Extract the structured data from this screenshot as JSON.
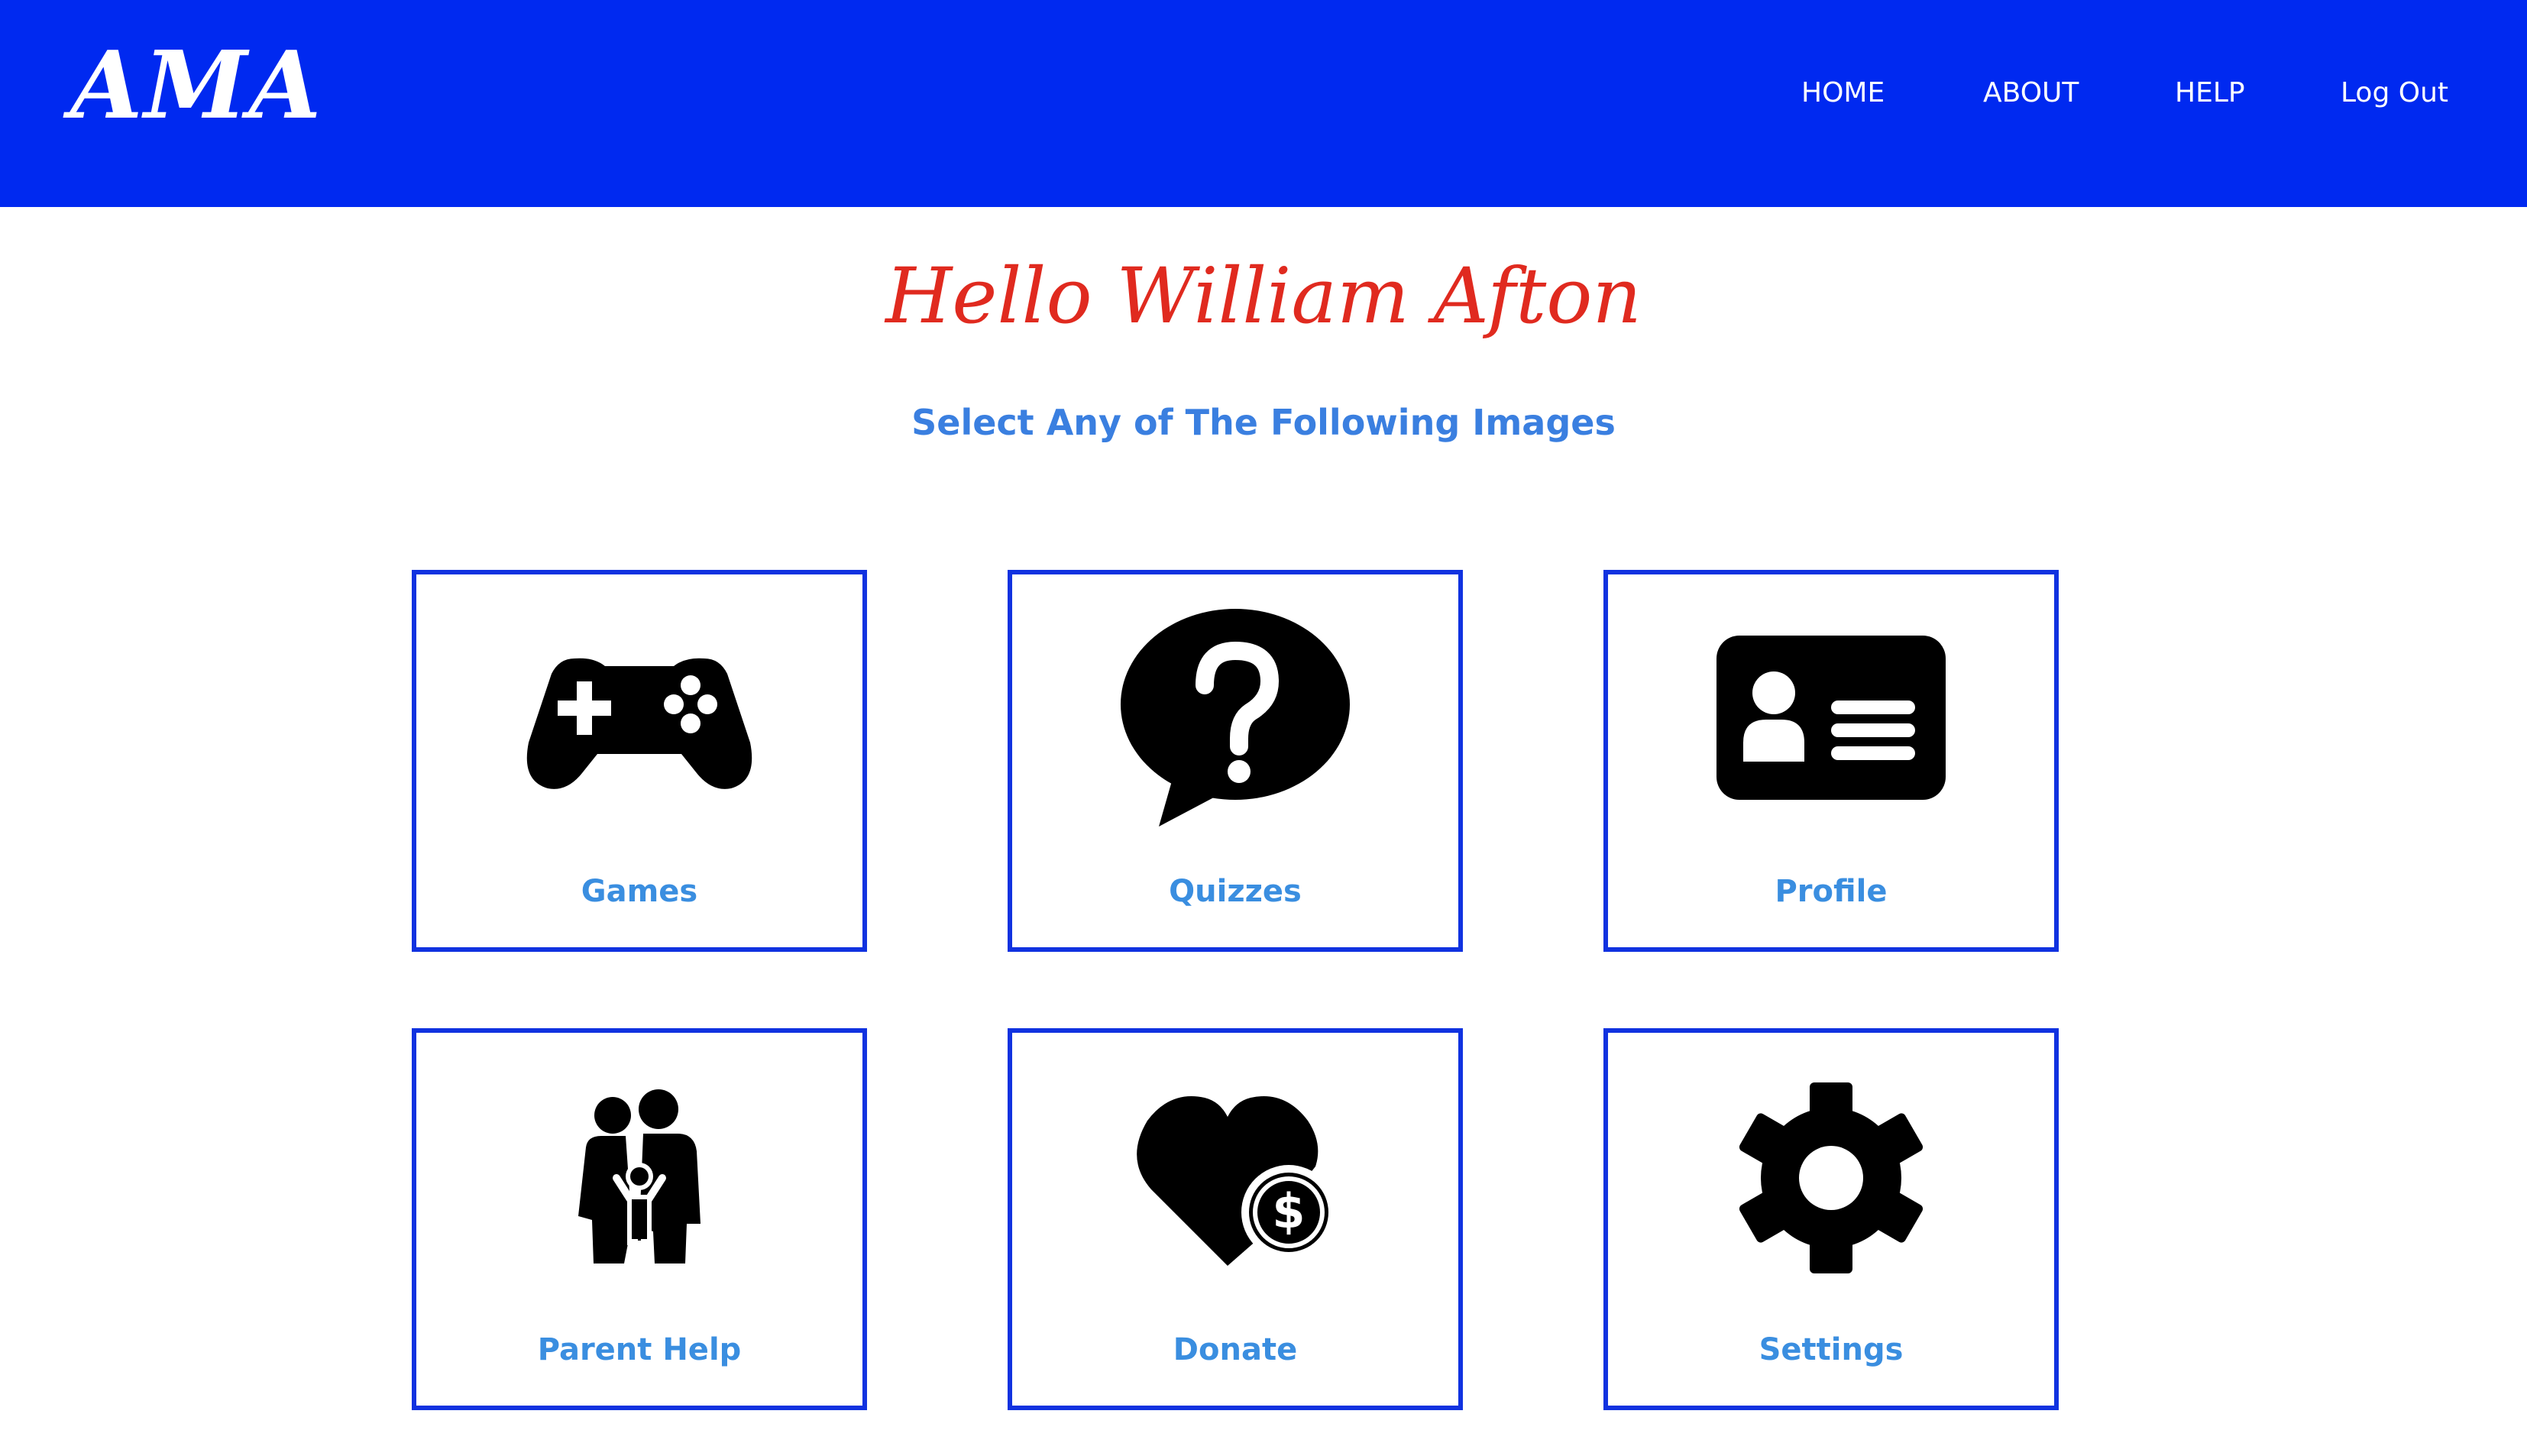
{
  "nav": {
    "logo": "AMA",
    "links": [
      "HOME",
      "ABOUT",
      "HELP",
      "Log Out"
    ]
  },
  "main": {
    "greeting": "Hello William Afton",
    "subtitle": "Select Any of The Following Images"
  },
  "cards": [
    {
      "label": "Games",
      "icon": "gamepad-icon"
    },
    {
      "label": "Quizzes",
      "icon": "question-bubble-icon"
    },
    {
      "label": "Profile",
      "icon": "id-card-icon"
    },
    {
      "label": "Parent Help",
      "icon": "family-icon"
    },
    {
      "label": "Donate",
      "icon": "heart-dollar-icon"
    },
    {
      "label": "Settings",
      "icon": "gear-icon"
    }
  ],
  "colors": {
    "navbar": "#0029f0",
    "greeting": "#e02a1f",
    "subtitle": "#3a7fe0",
    "card_border": "#1032e0",
    "card_label": "#3a8ee0"
  }
}
